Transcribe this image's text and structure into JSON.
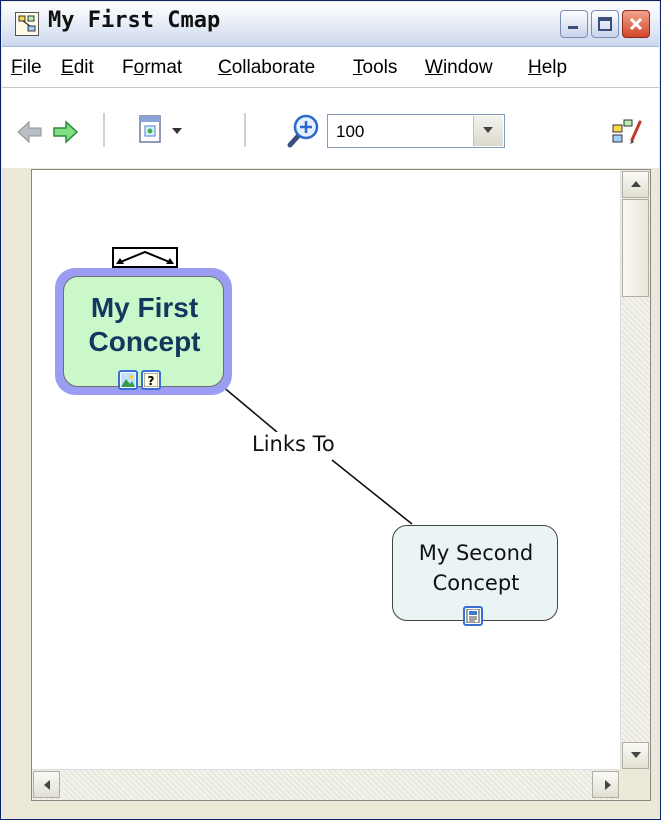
{
  "window": {
    "title": "My First Cmap",
    "controls": [
      "minimize-icon",
      "maximize-icon",
      "close-icon"
    ]
  },
  "menu": {
    "items": [
      {
        "underline": "F",
        "rest": "ile"
      },
      {
        "underline": "E",
        "rest": "dit"
      },
      {
        "before": "F",
        "underline": "o",
        "rest": "rmat"
      },
      {
        "underline": "C",
        "rest": "ollaborate"
      },
      {
        "underline": "T",
        "rest": "ools"
      },
      {
        "underline": "W",
        "rest": "indow"
      },
      {
        "underline": "H",
        "rest": "elp"
      }
    ]
  },
  "toolbar": {
    "icons": [
      "back-arrow-icon",
      "forward-arrow-icon",
      "view-options-icon",
      "zoom-in-icon",
      "styles-icon"
    ],
    "zoom_value": "100"
  },
  "map": {
    "concept1": {
      "line1": "My First",
      "line2": "Concept",
      "icons": [
        "image-resource-icon",
        "question-resource-icon"
      ]
    },
    "link_label": "Links To",
    "concept2": {
      "line1": "My Second",
      "line2": "Concept",
      "icons": [
        "document-resource-icon"
      ]
    }
  },
  "colors": {
    "selected_glow": "#9a9df2",
    "concept1_fill": "#cbf8cb",
    "concept1_text": "#14375e",
    "concept2_fill": "#eaf4f4"
  }
}
